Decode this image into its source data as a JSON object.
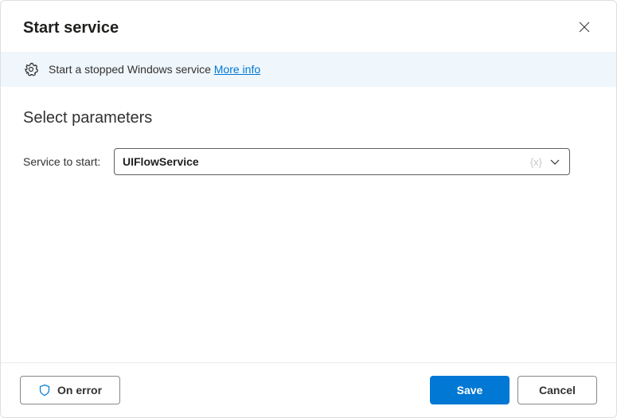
{
  "header": {
    "title": "Start service"
  },
  "banner": {
    "description": "Start a stopped Windows service",
    "link_label": "More info"
  },
  "content": {
    "section_title": "Select parameters",
    "param_label": "Service to start:",
    "combo_value": "UIFlowService",
    "combo_var_hint": "{x}"
  },
  "footer": {
    "on_error_label": "On error",
    "save_label": "Save",
    "cancel_label": "Cancel"
  }
}
